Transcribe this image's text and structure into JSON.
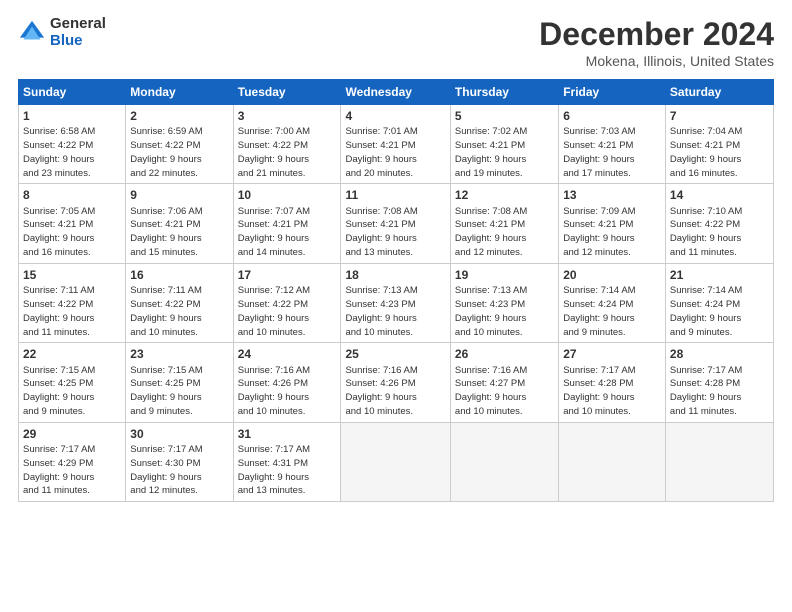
{
  "logo": {
    "general": "General",
    "blue": "Blue"
  },
  "title": "December 2024",
  "subtitle": "Mokena, Illinois, United States",
  "days_of_week": [
    "Sunday",
    "Monday",
    "Tuesday",
    "Wednesday",
    "Thursday",
    "Friday",
    "Saturday"
  ],
  "weeks": [
    [
      {
        "day": "1",
        "info": "Sunrise: 6:58 AM\nSunset: 4:22 PM\nDaylight: 9 hours\nand 23 minutes."
      },
      {
        "day": "2",
        "info": "Sunrise: 6:59 AM\nSunset: 4:22 PM\nDaylight: 9 hours\nand 22 minutes."
      },
      {
        "day": "3",
        "info": "Sunrise: 7:00 AM\nSunset: 4:22 PM\nDaylight: 9 hours\nand 21 minutes."
      },
      {
        "day": "4",
        "info": "Sunrise: 7:01 AM\nSunset: 4:21 PM\nDaylight: 9 hours\nand 20 minutes."
      },
      {
        "day": "5",
        "info": "Sunrise: 7:02 AM\nSunset: 4:21 PM\nDaylight: 9 hours\nand 19 minutes."
      },
      {
        "day": "6",
        "info": "Sunrise: 7:03 AM\nSunset: 4:21 PM\nDaylight: 9 hours\nand 17 minutes."
      },
      {
        "day": "7",
        "info": "Sunrise: 7:04 AM\nSunset: 4:21 PM\nDaylight: 9 hours\nand 16 minutes."
      }
    ],
    [
      {
        "day": "8",
        "info": "Sunrise: 7:05 AM\nSunset: 4:21 PM\nDaylight: 9 hours\nand 16 minutes."
      },
      {
        "day": "9",
        "info": "Sunrise: 7:06 AM\nSunset: 4:21 PM\nDaylight: 9 hours\nand 15 minutes."
      },
      {
        "day": "10",
        "info": "Sunrise: 7:07 AM\nSunset: 4:21 PM\nDaylight: 9 hours\nand 14 minutes."
      },
      {
        "day": "11",
        "info": "Sunrise: 7:08 AM\nSunset: 4:21 PM\nDaylight: 9 hours\nand 13 minutes."
      },
      {
        "day": "12",
        "info": "Sunrise: 7:08 AM\nSunset: 4:21 PM\nDaylight: 9 hours\nand 12 minutes."
      },
      {
        "day": "13",
        "info": "Sunrise: 7:09 AM\nSunset: 4:21 PM\nDaylight: 9 hours\nand 12 minutes."
      },
      {
        "day": "14",
        "info": "Sunrise: 7:10 AM\nSunset: 4:22 PM\nDaylight: 9 hours\nand 11 minutes."
      }
    ],
    [
      {
        "day": "15",
        "info": "Sunrise: 7:11 AM\nSunset: 4:22 PM\nDaylight: 9 hours\nand 11 minutes."
      },
      {
        "day": "16",
        "info": "Sunrise: 7:11 AM\nSunset: 4:22 PM\nDaylight: 9 hours\nand 10 minutes."
      },
      {
        "day": "17",
        "info": "Sunrise: 7:12 AM\nSunset: 4:22 PM\nDaylight: 9 hours\nand 10 minutes."
      },
      {
        "day": "18",
        "info": "Sunrise: 7:13 AM\nSunset: 4:23 PM\nDaylight: 9 hours\nand 10 minutes."
      },
      {
        "day": "19",
        "info": "Sunrise: 7:13 AM\nSunset: 4:23 PM\nDaylight: 9 hours\nand 10 minutes."
      },
      {
        "day": "20",
        "info": "Sunrise: 7:14 AM\nSunset: 4:24 PM\nDaylight: 9 hours\nand 9 minutes."
      },
      {
        "day": "21",
        "info": "Sunrise: 7:14 AM\nSunset: 4:24 PM\nDaylight: 9 hours\nand 9 minutes."
      }
    ],
    [
      {
        "day": "22",
        "info": "Sunrise: 7:15 AM\nSunset: 4:25 PM\nDaylight: 9 hours\nand 9 minutes."
      },
      {
        "day": "23",
        "info": "Sunrise: 7:15 AM\nSunset: 4:25 PM\nDaylight: 9 hours\nand 9 minutes."
      },
      {
        "day": "24",
        "info": "Sunrise: 7:16 AM\nSunset: 4:26 PM\nDaylight: 9 hours\nand 10 minutes."
      },
      {
        "day": "25",
        "info": "Sunrise: 7:16 AM\nSunset: 4:26 PM\nDaylight: 9 hours\nand 10 minutes."
      },
      {
        "day": "26",
        "info": "Sunrise: 7:16 AM\nSunset: 4:27 PM\nDaylight: 9 hours\nand 10 minutes."
      },
      {
        "day": "27",
        "info": "Sunrise: 7:17 AM\nSunset: 4:28 PM\nDaylight: 9 hours\nand 10 minutes."
      },
      {
        "day": "28",
        "info": "Sunrise: 7:17 AM\nSunset: 4:28 PM\nDaylight: 9 hours\nand 11 minutes."
      }
    ],
    [
      {
        "day": "29",
        "info": "Sunrise: 7:17 AM\nSunset: 4:29 PM\nDaylight: 9 hours\nand 11 minutes."
      },
      {
        "day": "30",
        "info": "Sunrise: 7:17 AM\nSunset: 4:30 PM\nDaylight: 9 hours\nand 12 minutes."
      },
      {
        "day": "31",
        "info": "Sunrise: 7:17 AM\nSunset: 4:31 PM\nDaylight: 9 hours\nand 13 minutes."
      },
      {
        "day": "",
        "info": ""
      },
      {
        "day": "",
        "info": ""
      },
      {
        "day": "",
        "info": ""
      },
      {
        "day": "",
        "info": ""
      }
    ]
  ]
}
